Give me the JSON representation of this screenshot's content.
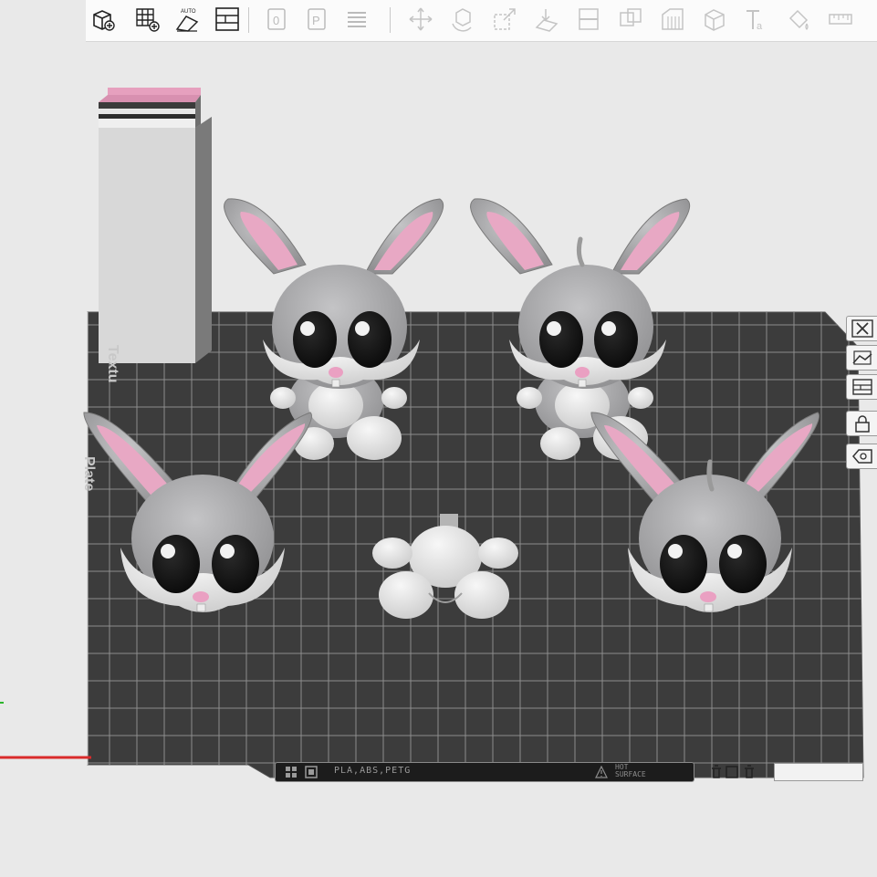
{
  "toolbar": {
    "tools": [
      {
        "name": "add-object-icon",
        "interactable": true
      },
      {
        "name": "add-plate-icon",
        "interactable": true
      },
      {
        "name": "auto-orient-icon",
        "interactable": true,
        "label": "AUTO"
      },
      {
        "name": "arrange-icon",
        "interactable": true
      },
      {
        "name": "separator",
        "interactable": false
      },
      {
        "name": "plate-orient-icon",
        "interactable": true
      },
      {
        "name": "plate-settings-icon",
        "interactable": true
      },
      {
        "name": "layers-icon",
        "interactable": true
      },
      {
        "name": "separator",
        "interactable": false
      },
      {
        "name": "move-icon",
        "interactable": true
      },
      {
        "name": "rotate-icon",
        "interactable": true
      },
      {
        "name": "scale-icon",
        "interactable": true
      },
      {
        "name": "lay-on-face-icon",
        "interactable": true
      },
      {
        "name": "cut-icon",
        "interactable": true
      },
      {
        "name": "boolean-icon",
        "interactable": true
      },
      {
        "name": "support-paint-icon",
        "interactable": true
      },
      {
        "name": "seam-paint-icon",
        "interactable": true
      },
      {
        "name": "text-icon",
        "interactable": true,
        "label": "Ta"
      },
      {
        "name": "color-paint-icon",
        "interactable": true
      },
      {
        "name": "measure-icon",
        "interactable": true
      }
    ]
  },
  "right_toolbar": [
    {
      "name": "close-view-icon"
    },
    {
      "name": "camera-view-icon"
    },
    {
      "name": "plate-arrange-icon"
    },
    {
      "name": "lock-icon"
    },
    {
      "name": "settings-tag-icon"
    }
  ],
  "plate": {
    "side_label_1": "Textu",
    "side_label_2": "Plate",
    "filament_text": "PLA,ABS,PETG",
    "hot_surface_line1": "HOT",
    "hot_surface_line2": "SURFACE"
  },
  "objects": [
    {
      "name": "bunny-full-1"
    },
    {
      "name": "bunny-full-2"
    },
    {
      "name": "bunny-head-1"
    },
    {
      "name": "bunny-body"
    },
    {
      "name": "bunny-head-2"
    },
    {
      "name": "wipe-tower"
    }
  ],
  "colors": {
    "plate": "#3c3c3c",
    "grid": "#8d8d8d",
    "bunny_gray": "#a7a7a9",
    "bunny_white": "#e6e6e6",
    "ear_pink": "#e8a8c4",
    "nose_pink": "#eaa0c2",
    "tower_pink": "#e6a0be",
    "background": "#e9e9e9"
  }
}
